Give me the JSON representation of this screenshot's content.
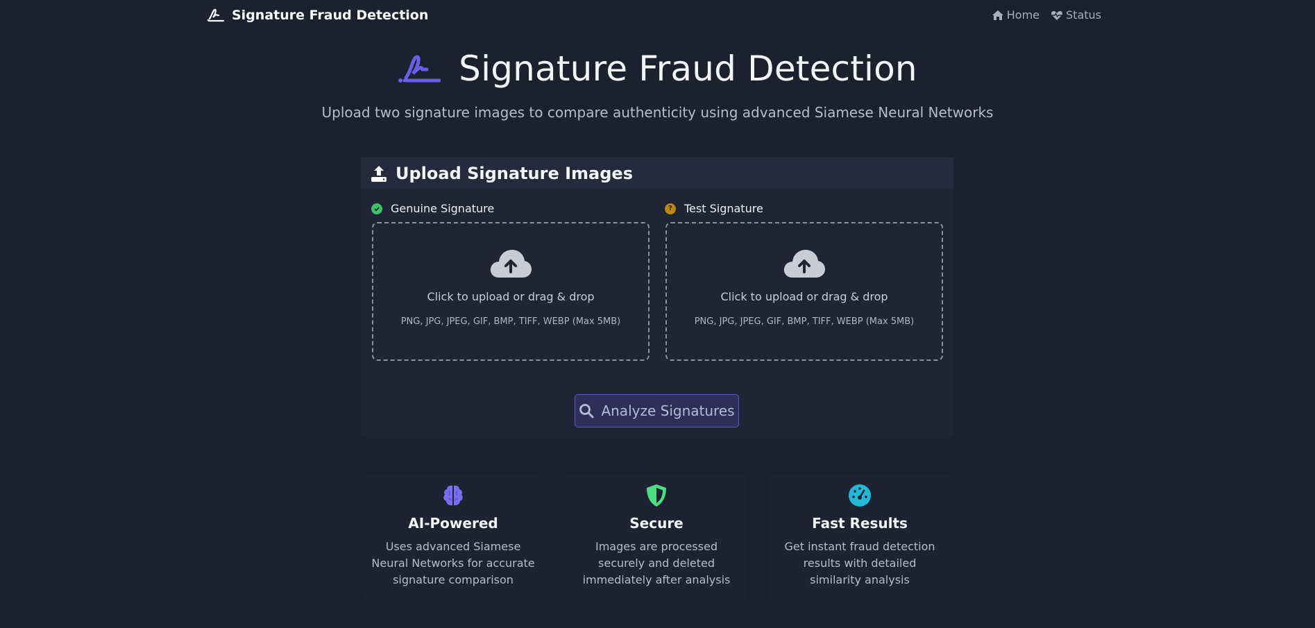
{
  "navbar": {
    "brand_icon": "signature-icon",
    "brand": "Signature Fraud Detection",
    "links": [
      {
        "icon": "home-icon",
        "label": "Home"
      },
      {
        "icon": "heart-pulse-icon",
        "label": "Status"
      }
    ]
  },
  "hero": {
    "icon": "signature-icon",
    "title": "Signature Fraud Detection",
    "subtitle": "Upload two signature images to compare authenticity using advanced Siamese Neural Networks"
  },
  "upload": {
    "header_icon": "upload-icon",
    "title": "Upload Signature Images",
    "genuine": {
      "icon": "check-circle-icon",
      "label": "Genuine Signature",
      "zone_icon": "cloud-upload-icon",
      "prompt": "Click to upload or drag & drop",
      "formats": "PNG, JPG, JPEG, GIF, BMP, TIFF, WEBP (Max 5MB)"
    },
    "test": {
      "icon": "question-circle-icon",
      "label": "Test Signature",
      "zone_icon": "cloud-upload-icon",
      "prompt": "Click to upload or drag & drop",
      "formats": "PNG, JPG, JPEG, GIF, BMP, TIFF, WEBP (Max 5MB)"
    },
    "analyze_icon": "search-icon",
    "analyze_label": "Analyze Signatures"
  },
  "features": [
    {
      "icon": "brain-icon",
      "title": "AI-Powered",
      "text": "Uses advanced Siamese Neural Networks for accurate signature comparison"
    },
    {
      "icon": "shield-icon",
      "title": "Secure",
      "text": "Images are processed securely and deleted immediately after analysis"
    },
    {
      "icon": "gauge-icon",
      "title": "Fast Results",
      "text": "Get instant fraud detection results with detailed similarity analysis"
    }
  ],
  "colors": {
    "background": "#1c2130",
    "accent": "#6c5ce7",
    "genuine": "#3fc06a",
    "test": "#b98a10",
    "secure": "#4ade80",
    "fast": "#22b8d6"
  }
}
